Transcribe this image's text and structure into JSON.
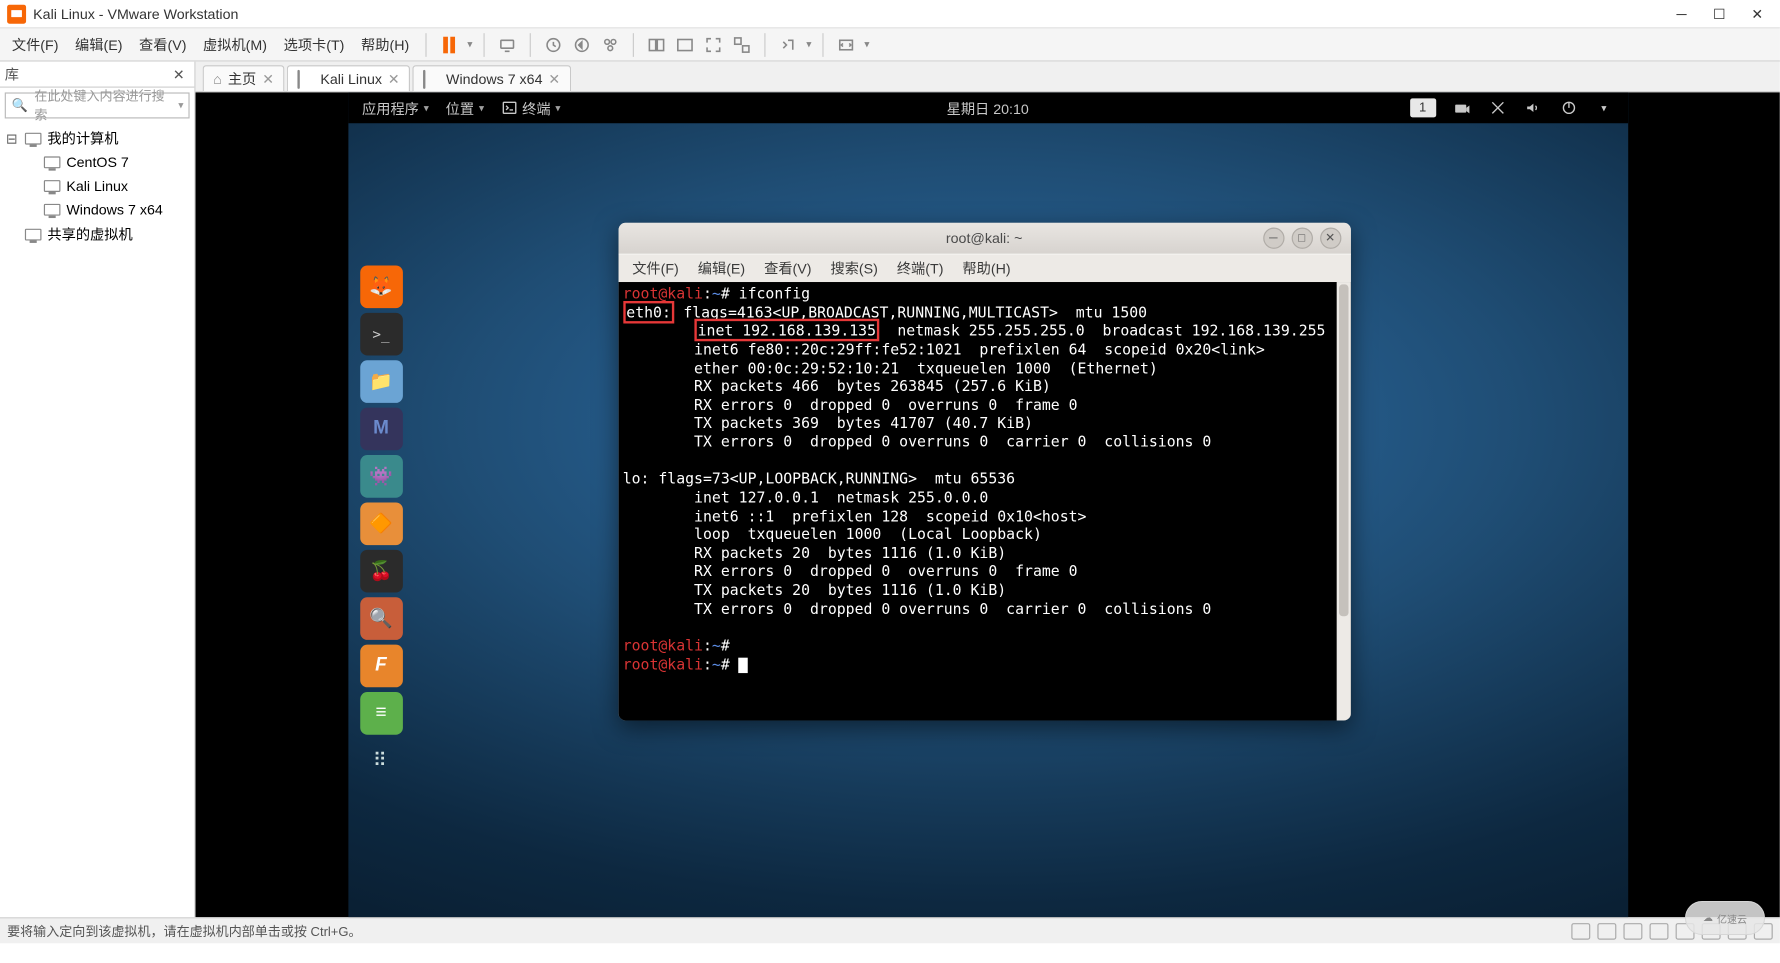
{
  "app": {
    "title": "Kali Linux - VMware Workstation"
  },
  "menu": {
    "file": "文件(F)",
    "edit": "编辑(E)",
    "view": "查看(V)",
    "vm": "虚拟机(M)",
    "tabs": "选项卡(T)",
    "help": "帮助(H)"
  },
  "sidebar": {
    "header": "库",
    "search_placeholder": "在此处键入内容进行搜索",
    "root": "我的计算机",
    "items": [
      "CentOS 7",
      "Kali Linux",
      "Windows 7 x64"
    ],
    "shared": "共享的虚拟机"
  },
  "tabs": {
    "home": "主页",
    "kali": "Kali Linux",
    "win7": "Windows 7 x64"
  },
  "kali_topbar": {
    "apps": "应用程序",
    "places": "位置",
    "terminal": "终端",
    "datetime": "星期日 20:10",
    "workspace": "1"
  },
  "term": {
    "title": "root@kali: ~",
    "menu": {
      "file": "文件(F)",
      "edit": "编辑(E)",
      "view": "查看(V)",
      "search": "搜索(S)",
      "terminal": "终端(T)",
      "help": "帮助(H)"
    },
    "prompt_user": "root@kali",
    "prompt_sep": ":",
    "prompt_path": "~",
    "prompt_hash": "#",
    "cmd1": "ifconfig",
    "eth0_label": "eth0:",
    "eth0_after": " flags=4163<UP,BROADCAST,RUNNING,MULTICAST>  mtu 1500",
    "inet_box": "inet 192.168.139.135",
    "inet_after": "  netmask 255.255.255.0  broadcast 192.168.139.255",
    "l3": "        inet6 fe80::20c:29ff:fe52:1021  prefixlen 64  scopeid 0x20<link>",
    "l4": "        ether 00:0c:29:52:10:21  txqueuelen 1000  (Ethernet)",
    "l5": "        RX packets 466  bytes 263845 (257.6 KiB)",
    "l6": "        RX errors 0  dropped 0  overruns 0  frame 0",
    "l7": "        TX packets 369  bytes 41707 (40.7 KiB)",
    "l8": "        TX errors 0  dropped 0 overruns 0  carrier 0  collisions 0",
    "lo1": "lo: flags=73<UP,LOOPBACK,RUNNING>  mtu 65536",
    "lo2": "        inet 127.0.0.1  netmask 255.0.0.0",
    "lo3": "        inet6 ::1  prefixlen 128  scopeid 0x10<host>",
    "lo4": "        loop  txqueuelen 1000  (Local Loopback)",
    "lo5": "        RX packets 20  bytes 1116 (1.0 KiB)",
    "lo6": "        RX errors 0  dropped 0  overruns 0  frame 0",
    "lo7": "        TX packets 20  bytes 1116 (1.0 KiB)",
    "lo8": "        TX errors 0  dropped 0 overruns 0  carrier 0  collisions 0"
  },
  "status": "要将输入定向到该虚拟机，请在虚拟机内部单击或按 Ctrl+G。",
  "watermark": "亿速云"
}
